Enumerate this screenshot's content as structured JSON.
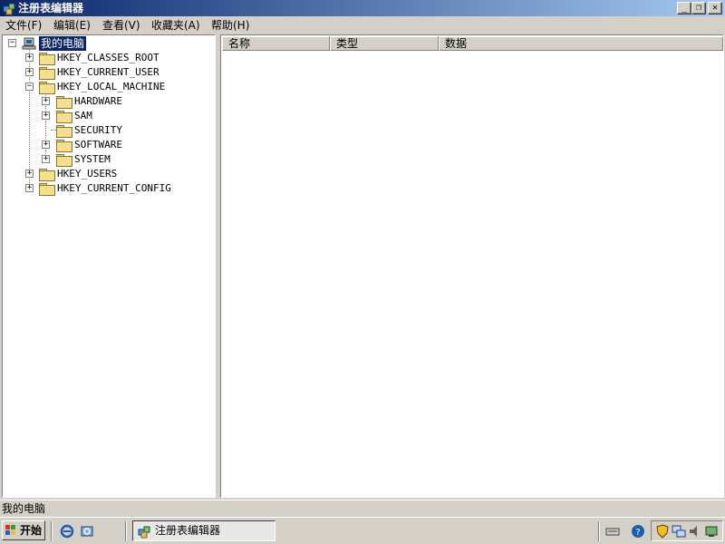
{
  "window": {
    "title": "注册表编辑器"
  },
  "menu": [
    {
      "label": "文件(F)"
    },
    {
      "label": "编辑(E)"
    },
    {
      "label": "查看(V)"
    },
    {
      "label": "收藏夹(A)"
    },
    {
      "label": "帮助(H)"
    }
  ],
  "tree": {
    "root": "我的电脑",
    "hives": {
      "classes_root": "HKEY_CLASSES_ROOT",
      "current_user": "HKEY_CURRENT_USER",
      "local_machine": "HKEY_LOCAL_MACHINE",
      "users": "HKEY_USERS",
      "current_config": "HKEY_CURRENT_CONFIG"
    },
    "local_machine_children": {
      "hardware": "HARDWARE",
      "sam": "SAM",
      "security": "SECURITY",
      "software": "SOFTWARE",
      "system": "SYSTEM"
    }
  },
  "list": {
    "columns": {
      "name": "名称",
      "type": "类型",
      "data": "数据"
    }
  },
  "status": {
    "text": "我的电脑"
  },
  "taskbar": {
    "start_label": "开始",
    "task_label": "注册表编辑器"
  },
  "colors": {
    "title_active": "#0a246a",
    "face": "#d4d0c8",
    "selection": "#0a246a"
  }
}
